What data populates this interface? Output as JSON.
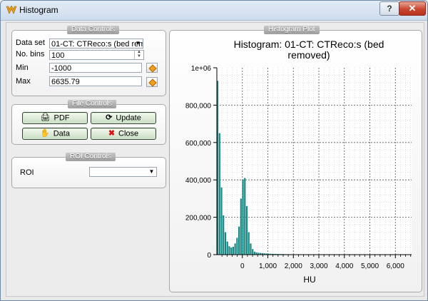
{
  "window": {
    "title": "Histogram",
    "help_label": "?",
    "close_label": "✕"
  },
  "data_controls": {
    "title": "Data Controls",
    "dataset_label": "Data set",
    "dataset_value": "01-CT: CTReco:s (bed rem",
    "bins_label": "No. bins",
    "bins_value": "100",
    "min_label": "Min",
    "min_value": "-1000",
    "max_label": "Max",
    "max_value": "6635.79"
  },
  "file_controls": {
    "title": "File Controls",
    "pdf_label": "PDF",
    "update_label": "Update",
    "data_label": "Data",
    "close_label": "Close"
  },
  "roi_controls": {
    "title": "ROI Controls",
    "roi_label": "ROI",
    "roi_value": ""
  },
  "plot_group": {
    "title": "Histogram Plot"
  },
  "chart_data": {
    "type": "bar",
    "title_line1": "Histogram: 01-CT: CTReco:s (bed",
    "title_line2": "removed)",
    "xlabel": "HU",
    "ylabel": "",
    "xlim": [
      -1000,
      6635.79
    ],
    "ylim": [
      0,
      1000000
    ],
    "x_ticks": [
      0,
      1000,
      2000,
      3000,
      4000,
      5000,
      6000
    ],
    "x_tick_labels": [
      "0",
      "1,000",
      "2,000",
      "3,000",
      "4,000",
      "5,000",
      "6,000"
    ],
    "y_ticks": [
      0,
      200000,
      400000,
      600000,
      800000,
      1000000
    ],
    "y_tick_labels": [
      "0",
      "200,000",
      "400,000",
      "600,000",
      "800,000",
      "1e+06"
    ],
    "bar_color": "#158782",
    "grid": true,
    "x": [
      -962,
      -885,
      -809,
      -733,
      -656,
      -580,
      -504,
      -427,
      -351,
      -275,
      -198,
      -122,
      -46,
      31,
      107,
      183,
      260,
      336,
      412,
      489,
      565,
      641,
      718,
      794,
      870,
      947,
      1023,
      1099,
      1176,
      1252,
      1328,
      1405,
      1481,
      1557,
      1634,
      1710,
      1786,
      1863,
      1939,
      2015,
      2092,
      2168,
      2244,
      2321,
      2397,
      2473,
      2550,
      2626,
      2702,
      2779
    ],
    "values": [
      930000,
      650000,
      360000,
      210000,
      120000,
      70000,
      45000,
      38000,
      42000,
      60000,
      90000,
      150000,
      300000,
      400000,
      410000,
      260000,
      120000,
      60000,
      30000,
      16000,
      12000,
      10000,
      9000,
      8000,
      7000,
      6000,
      5500,
      5000,
      4500,
      4000,
      3800,
      3500,
      3300,
      3000,
      2800,
      2600,
      2400,
      2200,
      2000,
      1900,
      1800,
      1700,
      1600,
      1500,
      1400,
      1300,
      1200,
      1100,
      1000,
      900
    ]
  }
}
